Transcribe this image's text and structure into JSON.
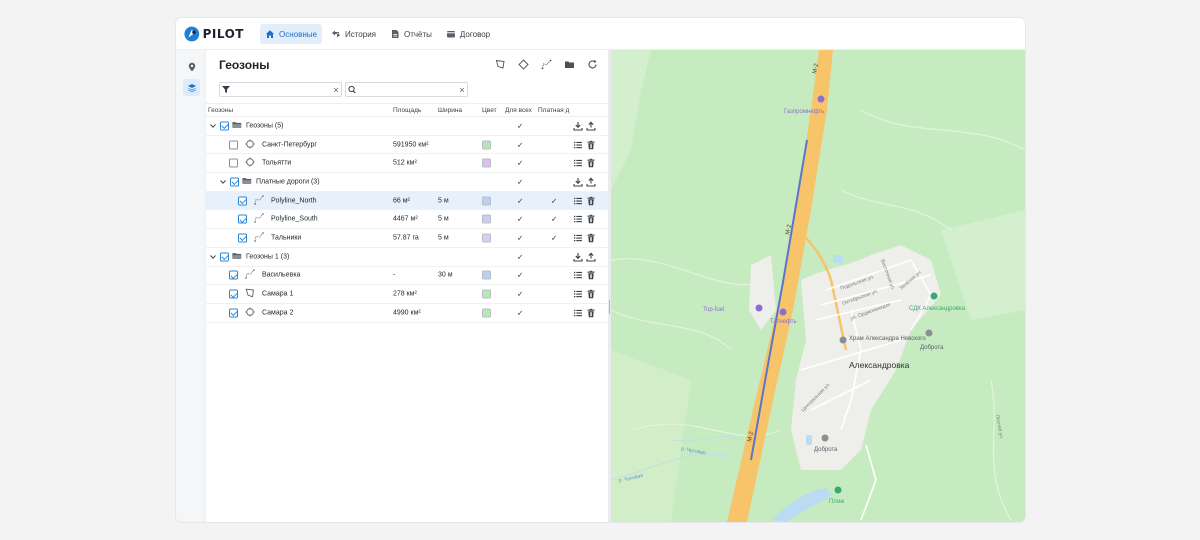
{
  "app": {
    "logo_text": "PILOT",
    "nav": [
      {
        "label": "Основные",
        "icon": "home-icon",
        "active": true
      },
      {
        "label": "История",
        "icon": "route-icon",
        "active": false
      },
      {
        "label": "Отчёты",
        "icon": "report-icon",
        "active": false
      },
      {
        "label": "Договор",
        "icon": "wallet-icon",
        "active": false
      }
    ],
    "rail": [
      "map-pin-icon",
      "layers-icon"
    ]
  },
  "panel": {
    "title": "Геозоны",
    "tools": [
      "polygon-icon",
      "circle-zone-icon",
      "polyline-icon",
      "folder-icon",
      "refresh-icon"
    ],
    "filter_value": "",
    "search_value": ""
  },
  "table": {
    "headers": [
      "Геозоны",
      "Площадь",
      "Ширина",
      "Цвет",
      "Для всех",
      "Платная д"
    ],
    "rows": [
      {
        "name": "Геозоны (5)",
        "type": "folder",
        "level": 0,
        "expanded": true,
        "checked": true,
        "area": "",
        "width": "",
        "color": "",
        "for_all": "✓",
        "paid": ""
      },
      {
        "name": "Санкт-Петербург",
        "type": "circle",
        "level": 1,
        "checked": false,
        "area": "591950 км²",
        "width": "",
        "color": "#b7e4b0",
        "for_all": "✓",
        "paid": ""
      },
      {
        "name": "Тольятти",
        "type": "circle",
        "level": 1,
        "checked": false,
        "area": "512 км²",
        "width": "",
        "color": "#d7bff0",
        "for_all": "✓",
        "paid": ""
      },
      {
        "name": "Платные дороги (3)",
        "type": "folder",
        "level": 1,
        "expanded": true,
        "checked": true,
        "area": "",
        "width": "",
        "color": "",
        "for_all": "✓",
        "paid": ""
      },
      {
        "name": "Polyline_North",
        "type": "polyline",
        "level": 2,
        "checked": true,
        "selected": true,
        "area": "66 м²",
        "width": "5 м",
        "color": "#bcd0f2",
        "for_all": "✓",
        "paid": "✓"
      },
      {
        "name": "Polyline_South",
        "type": "polyline",
        "level": 2,
        "checked": true,
        "area": "4467 м²",
        "width": "5 м",
        "color": "#d2c8f2",
        "for_all": "✓",
        "paid": "✓"
      },
      {
        "name": "Тальники",
        "type": "polyline",
        "level": 2,
        "checked": true,
        "area": "57.87 га",
        "width": "5 м",
        "color": "#dfcbf2",
        "for_all": "✓",
        "paid": "✓"
      },
      {
        "name": "Геозоны 1 (3)",
        "type": "folder",
        "level": 0,
        "expanded": true,
        "checked": true,
        "area": "",
        "width": "",
        "color": "",
        "for_all": "✓",
        "paid": ""
      },
      {
        "name": "Васильевка",
        "type": "polyline",
        "level": 1,
        "checked": true,
        "area": "-",
        "width": "30 м",
        "color": "#bcd0f2",
        "for_all": "✓",
        "paid": ""
      },
      {
        "name": "Самара 1",
        "type": "polygon",
        "level": 1,
        "checked": true,
        "area": "278 км²",
        "width": "",
        "color": "#b7eab0",
        "for_all": "✓",
        "paid": ""
      },
      {
        "name": "Самара 2",
        "type": "circle",
        "level": 1,
        "checked": true,
        "area": "4990 км²",
        "width": "",
        "color": "#b7eab0",
        "for_all": "✓",
        "paid": ""
      }
    ]
  },
  "map": {
    "labels": [
      {
        "text": "М-2",
        "kind": "road"
      },
      {
        "text": "Газпромнефть",
        "kind": "poi"
      },
      {
        "text": "Top-fuel",
        "kind": "poi"
      },
      {
        "text": "Татнефть",
        "kind": "poi"
      },
      {
        "text": "Подольская ул.",
        "kind": "street"
      },
      {
        "text": "Октябрьская ул.",
        "kind": "street"
      },
      {
        "text": "ул. Орджоникидзе",
        "kind": "street"
      },
      {
        "text": "Восточная ул.",
        "kind": "street"
      },
      {
        "text": "Зелёная ул.",
        "kind": "street"
      },
      {
        "text": "СДК Александровка",
        "kind": "poi"
      },
      {
        "text": "Храм Александра Невского",
        "kind": "poi"
      },
      {
        "text": "Доброта",
        "kind": "poi"
      },
      {
        "text": "Александровка",
        "kind": "place"
      },
      {
        "text": "Центральная ул.",
        "kind": "street"
      },
      {
        "text": "Пляж",
        "kind": "poi"
      },
      {
        "text": "р. Чусовая",
        "kind": "water"
      },
      {
        "text": "Лесная ул.",
        "kind": "street"
      }
    ],
    "colors": {
      "forest": "#c7ebc0",
      "road": "#f7c46a",
      "route": "#5b74c9",
      "settlement": "#eeeeea",
      "water": "#b9dcf2"
    }
  }
}
